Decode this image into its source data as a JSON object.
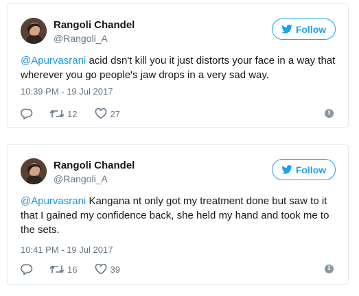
{
  "colors": {
    "brand_blue": "#1da1f2",
    "link_blue": "#1b95e0",
    "muted_gray": "#657786",
    "border": "#e1e8ed"
  },
  "tweets": [
    {
      "author_name": "Rangoli Chandel",
      "author_handle": "@Rangoli_A",
      "follow_label": "Follow",
      "mention": "@Apurvasrani",
      "text": " acid dsn't kill you it just distorts your face in a way that wherever you go people's jaw drops in a very sad way.",
      "timestamp": "10:39 PM - 19 Jul 2017",
      "reply_icon": "reply-icon",
      "retweet_count": "12",
      "like_count": "27"
    },
    {
      "author_name": "Rangoli Chandel",
      "author_handle": "@Rangoli_A",
      "follow_label": "Follow",
      "mention": "@Apurvasrani",
      "text": " Kangana nt only got my treatment done but saw to it that I gained my confidence back, she held my hand and took me to the sets.",
      "timestamp": "10:41 PM - 19 Jul 2017",
      "reply_icon": "reply-icon",
      "retweet_count": "16",
      "like_count": "39"
    }
  ]
}
